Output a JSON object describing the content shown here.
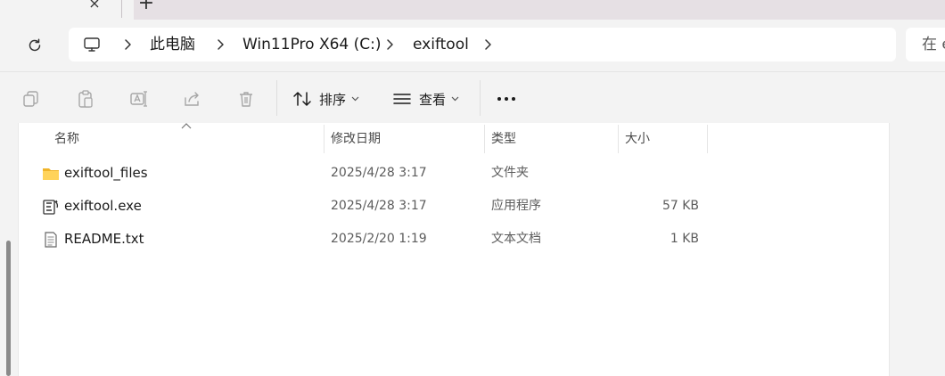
{
  "tab": {
    "close_glyph": "×",
    "new_tab_glyph": "+"
  },
  "address": {
    "crumbs": [
      "此电脑",
      "Win11Pro X64 (C:)",
      "exiftool"
    ]
  },
  "search": {
    "placeholder_visible": "在 e"
  },
  "toolbar": {
    "sort_label": "排序",
    "view_label": "查看"
  },
  "columns": {
    "name": "名称",
    "date": "修改日期",
    "type": "类型",
    "size": "大小"
  },
  "files": [
    {
      "name": "exiftool_files",
      "date": "2025/4/28 3:17",
      "type": "文件夹",
      "size": "",
      "icon": "folder-icon"
    },
    {
      "name": "exiftool.exe",
      "date": "2025/4/28 3:17",
      "type": "应用程序",
      "size": "57 KB",
      "icon": "exe-app-icon"
    },
    {
      "name": "README.txt",
      "date": "2025/2/20 1:19",
      "type": "文本文档",
      "size": "1 KB",
      "icon": "text-file-icon"
    }
  ],
  "colors": {
    "accent_folder": "#f5c242",
    "window_bg": "#f3f3f3",
    "content_bg": "#ffffff"
  }
}
